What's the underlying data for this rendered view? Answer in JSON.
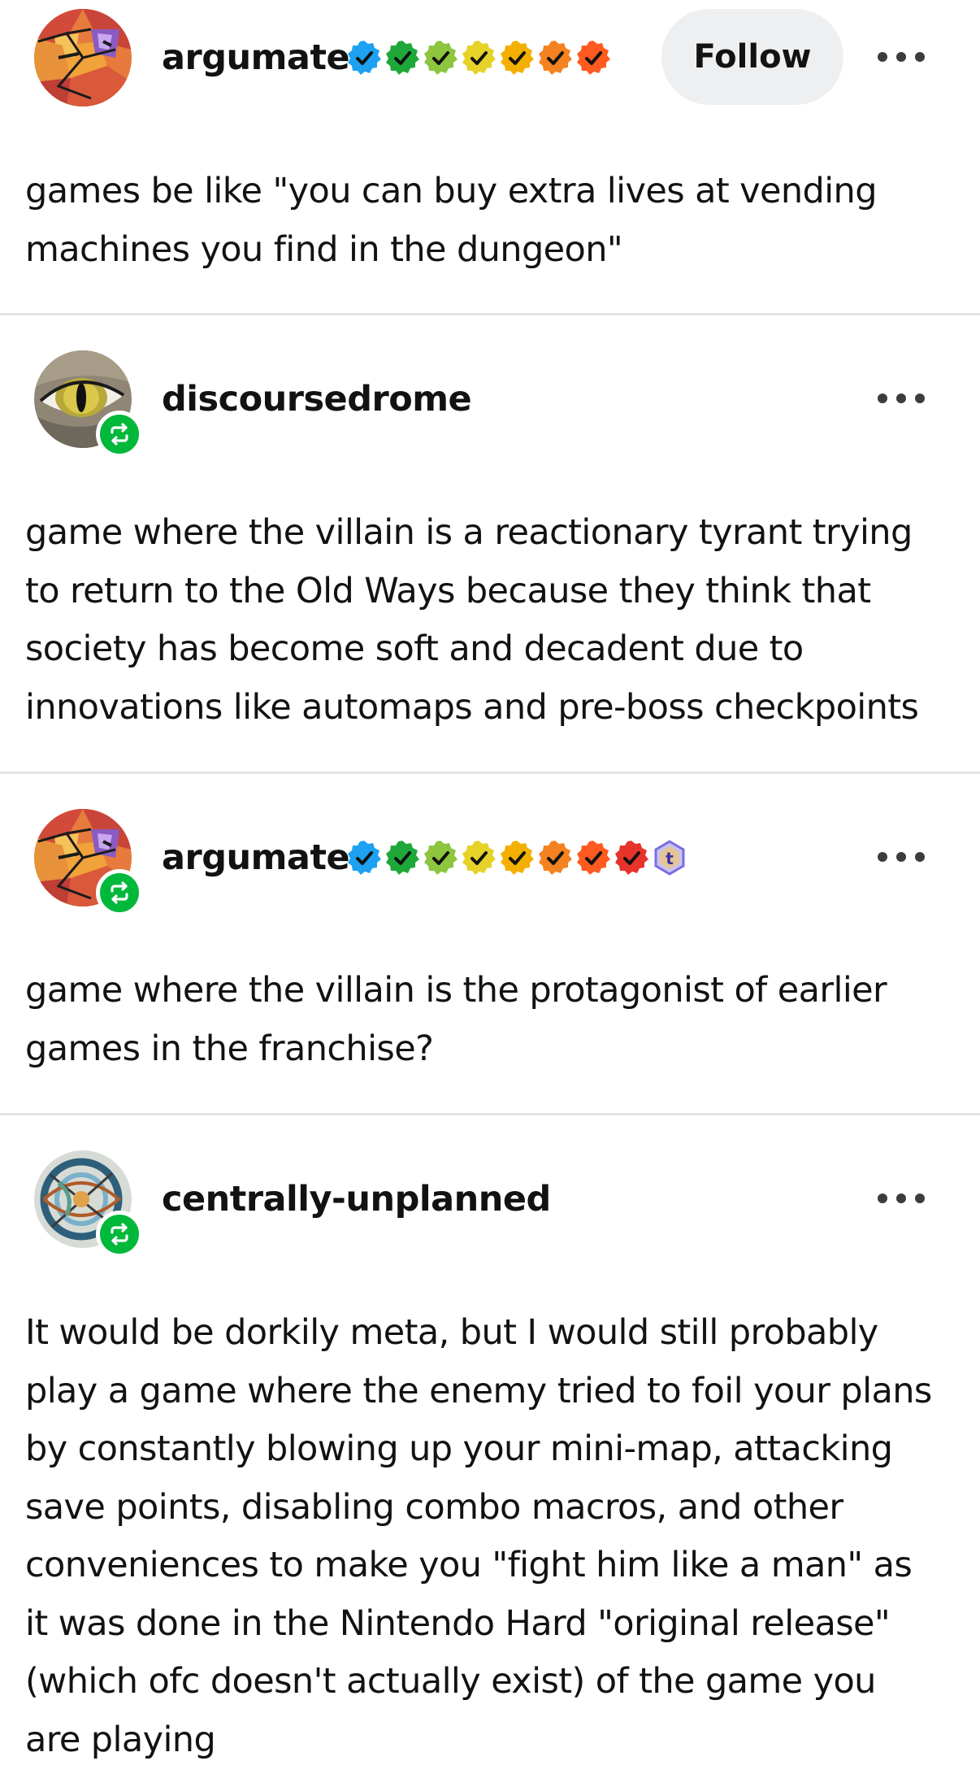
{
  "posts": [
    {
      "username": "argumate",
      "avatar": "geometric-face-avatar",
      "is_reblog": false,
      "badge_colors": [
        "#1da1f2",
        "#1fa83a",
        "#8dc53e",
        "#e7d22a",
        "#f4b000",
        "#f58220",
        "#ff5a1f"
      ],
      "follow_label": "Follow",
      "text": "games be like \"you can buy extra lives at vending\nmachines you find in the dungeon\""
    },
    {
      "username": "discoursedrome",
      "avatar": "cat-eye-avatar",
      "is_reblog": true,
      "badge_colors": [],
      "text": "game where the villain is a reactionary tyrant trying\nto return to the Old Ways because they think that\nsociety has become soft and decadent due to\ninnovations like automaps and pre-boss checkpoints"
    },
    {
      "username": "argumate",
      "avatar": "geometric-face-avatar",
      "is_reblog": true,
      "badge_colors": [
        "#1da1f2",
        "#1fa83a",
        "#8dc53e",
        "#e7d22a",
        "#f4b000",
        "#f58220",
        "#ff5a1f",
        "#e8322c"
      ],
      "extra_badge": "tumblr-t-badge",
      "text": "game where the villain is the protagonist of earlier\ngames in the franchise?"
    },
    {
      "username": "centrally-unplanned",
      "avatar": "abstract-swirl-avatar",
      "is_reblog": true,
      "badge_colors": [],
      "text": "It would be dorkily meta, but I would still probably\nplay a game where the enemy tried to foil your plans\nby constantly blowing up your mini-map, attacking\nsave points, disabling combo macros, and other\nconveniences to make you \"fight him like a man\" as\nit was done in the Nintendo Hard \"original release\"\n(which ofc doesn't actually exist) of the game you\nare playing"
    }
  ],
  "icons": {
    "more": "more-options-icon",
    "reblog": "reblog-icon",
    "checkmark": "verified-check-icon"
  }
}
